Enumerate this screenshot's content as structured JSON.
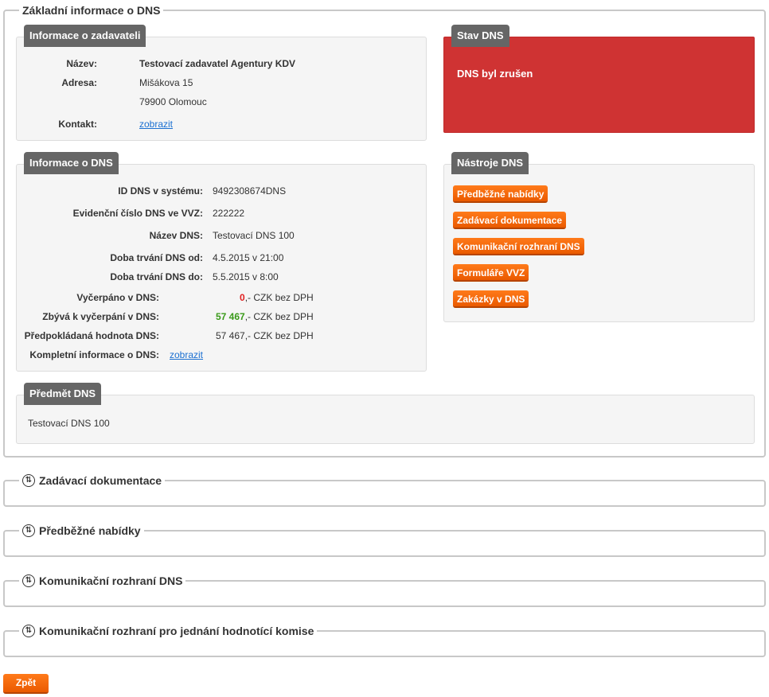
{
  "main_section": {
    "legend": "Základní informace o DNS"
  },
  "zadavatel": {
    "tag": "Informace o zadavateli",
    "name_label": "Název:",
    "name_value": "Testovací zadavatel Agentury KDV",
    "address_label": "Adresa:",
    "address_line1": "Mišákova 15",
    "address_line2": "79900 Olomouc",
    "contact_label": "Kontakt:",
    "contact_link": "zobrazit"
  },
  "stav": {
    "tag": "Stav DNS",
    "status_text": "DNS byl zrušen",
    "color": "#cf3333"
  },
  "dns_info": {
    "tag": "Informace o DNS",
    "rows": [
      {
        "label": "ID DNS v systému:",
        "value": "9492308674DNS"
      },
      {
        "label": "Evidenční číslo DNS ve VVZ:",
        "value": "222222"
      },
      {
        "label": "Název DNS:",
        "value": "Testovací DNS 100"
      },
      {
        "label": "Doba trvání DNS od:",
        "value": "4.5.2015 v 21:00"
      },
      {
        "label": "Doba trvání DNS do:",
        "value": "5.5.2015 v 8:00"
      }
    ],
    "used_label": "Vyčerpáno v DNS:",
    "used_amount": "0",
    "used_suffix": ",- CZK bez DPH",
    "remaining_label": "Zbývá k vyčerpání v DNS:",
    "remaining_amount": "57 467",
    "remaining_suffix": ",- CZK bez DPH",
    "expected_label": "Předpokládaná hodnota DNS:",
    "expected_value": "57 467,- CZK bez DPH",
    "complete_label": "Kompletní informace o DNS:",
    "complete_link": "zobrazit"
  },
  "nastroje": {
    "tag": "Nástroje DNS",
    "buttons": [
      "Předběžné nabídky",
      "Zadávací dokumentace",
      "Komunikační rozhraní DNS",
      "Formuláře VVZ",
      "Zakázky v DNS"
    ]
  },
  "predmet": {
    "tag": "Předmět DNS",
    "text": "Testovací DNS 100"
  },
  "collapsed_sections": [
    "Zadávací dokumentace",
    "Předběžné nabídky",
    "Komunikační rozhraní DNS",
    "Komunikační rozhraní pro jednání hodnotící komise"
  ],
  "back_button": "Zpět",
  "colors": {
    "accent_orange": "#f06a0a",
    "red_amount": "#e02020",
    "green_amount": "#3a9a1a",
    "link": "#1a6fd1"
  }
}
